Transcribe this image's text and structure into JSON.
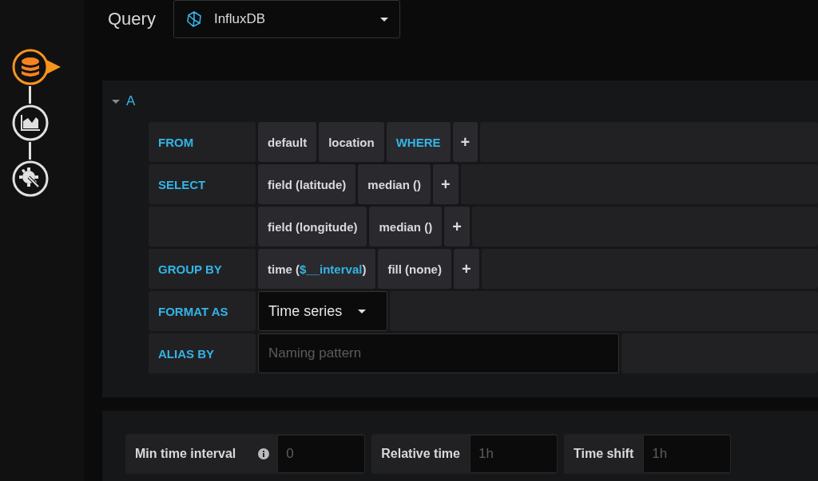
{
  "header": {
    "title": "Query",
    "datasource": {
      "name": "InfluxDB"
    }
  },
  "sidebar": {
    "items": [
      {
        "kind": "database",
        "selected": true
      },
      {
        "kind": "chart",
        "selected": false
      },
      {
        "kind": "settings",
        "selected": false
      }
    ]
  },
  "query": {
    "name": "A",
    "expanded": true,
    "rows": [
      {
        "label": "FROM",
        "segments": [
          {
            "kind": "tag",
            "parts": [
              {
                "text": "default",
                "kind": "plain"
              }
            ]
          },
          {
            "kind": "tag",
            "parts": [
              {
                "text": "location",
                "kind": "plain"
              }
            ]
          },
          {
            "kind": "keyword",
            "parts": [
              {
                "text": "WHERE",
                "kind": "plain"
              }
            ]
          },
          {
            "kind": "plus",
            "parts": [
              {
                "text": "+",
                "kind": "plain"
              }
            ]
          }
        ]
      },
      {
        "label": "SELECT",
        "segments": [
          {
            "kind": "tag",
            "parts": [
              {
                "text": "field (latitude)",
                "kind": "plain"
              }
            ]
          },
          {
            "kind": "tag",
            "parts": [
              {
                "text": "median ()",
                "kind": "plain"
              }
            ]
          },
          {
            "kind": "plus",
            "parts": [
              {
                "text": "+",
                "kind": "plain"
              }
            ]
          }
        ]
      },
      {
        "segments": [
          {
            "kind": "tag",
            "parts": [
              {
                "text": "field (longitude)",
                "kind": "plain"
              }
            ]
          },
          {
            "kind": "tag",
            "parts": [
              {
                "text": "median ()",
                "kind": "plain"
              }
            ]
          },
          {
            "kind": "plus",
            "parts": [
              {
                "text": "+",
                "kind": "plain"
              }
            ]
          }
        ]
      },
      {
        "label": "GROUP BY",
        "segments": [
          {
            "kind": "tag",
            "parts": [
              {
                "text": "time (",
                "kind": "plain"
              },
              {
                "text": "$__interval",
                "kind": "variable"
              },
              {
                "text": ")",
                "kind": "plain"
              }
            ]
          },
          {
            "kind": "tag",
            "parts": [
              {
                "text": "fill (none)",
                "kind": "plain"
              }
            ]
          },
          {
            "kind": "plus",
            "parts": [
              {
                "text": "+",
                "kind": "plain"
              }
            ]
          }
        ]
      },
      {
        "label": "FORMAT AS",
        "segments": [
          {
            "kind": "dropdown",
            "parts": [
              {
                "text": "Time series",
                "kind": "plain"
              }
            ]
          }
        ]
      },
      {
        "label": "ALIAS BY",
        "segments": [
          {
            "kind": "input",
            "placeholder": "Naming pattern"
          }
        ]
      }
    ]
  },
  "options": [
    {
      "label": "Min time interval",
      "info": true,
      "placeholder": "0"
    },
    {
      "label": "Relative time",
      "info": false,
      "placeholder": "1h"
    },
    {
      "label": "Time shift",
      "info": false,
      "placeholder": "1h"
    }
  ]
}
